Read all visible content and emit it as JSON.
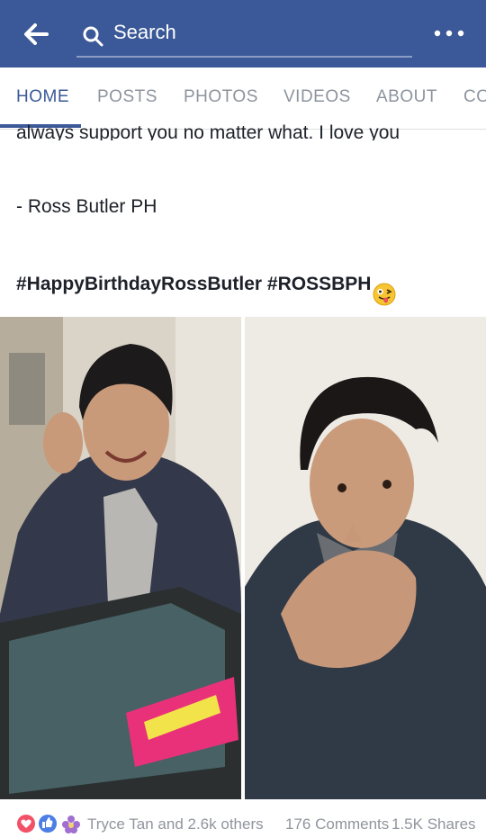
{
  "header": {
    "search_placeholder": "Search",
    "colors": {
      "bar": "#3b5998",
      "accent": "#3b5998"
    }
  },
  "icons": [
    "back-arrow-icon",
    "search-icon",
    "more-options-icon",
    "grinning-tongue-emoji",
    "love-reaction-icon",
    "like-reaction-icon",
    "sparkle-reaction-icon"
  ],
  "tabs": [
    {
      "label": "HOME",
      "active": true
    },
    {
      "label": "POSTS"
    },
    {
      "label": "PHOTOS"
    },
    {
      "label": "VIDEOS"
    },
    {
      "label": "ABOUT"
    },
    {
      "label": "CO"
    }
  ],
  "post": {
    "partial_line": "always support you no matter what. I love you",
    "signature": "- Ross Butler PH",
    "hashtags": "#HappyBirthdayRossButler #ROSSBPH"
  },
  "footer": {
    "reactions_text": "Tryce Tan and 2.6k others",
    "comments": "176 Comments",
    "shares": "1.5K Shares"
  }
}
